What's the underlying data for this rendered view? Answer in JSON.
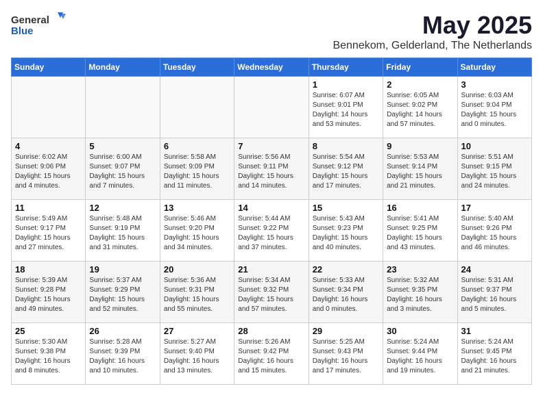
{
  "header": {
    "logo_general": "General",
    "logo_blue": "Blue",
    "month_year": "May 2025",
    "location": "Bennekom, Gelderland, The Netherlands"
  },
  "weekdays": [
    "Sunday",
    "Monday",
    "Tuesday",
    "Wednesday",
    "Thursday",
    "Friday",
    "Saturday"
  ],
  "weeks": [
    [
      {
        "day": "",
        "info": ""
      },
      {
        "day": "",
        "info": ""
      },
      {
        "day": "",
        "info": ""
      },
      {
        "day": "",
        "info": ""
      },
      {
        "day": "1",
        "info": "Sunrise: 6:07 AM\nSunset: 9:01 PM\nDaylight: 14 hours\nand 53 minutes."
      },
      {
        "day": "2",
        "info": "Sunrise: 6:05 AM\nSunset: 9:02 PM\nDaylight: 14 hours\nand 57 minutes."
      },
      {
        "day": "3",
        "info": "Sunrise: 6:03 AM\nSunset: 9:04 PM\nDaylight: 15 hours\nand 0 minutes."
      }
    ],
    [
      {
        "day": "4",
        "info": "Sunrise: 6:02 AM\nSunset: 9:06 PM\nDaylight: 15 hours\nand 4 minutes."
      },
      {
        "day": "5",
        "info": "Sunrise: 6:00 AM\nSunset: 9:07 PM\nDaylight: 15 hours\nand 7 minutes."
      },
      {
        "day": "6",
        "info": "Sunrise: 5:58 AM\nSunset: 9:09 PM\nDaylight: 15 hours\nand 11 minutes."
      },
      {
        "day": "7",
        "info": "Sunrise: 5:56 AM\nSunset: 9:11 PM\nDaylight: 15 hours\nand 14 minutes."
      },
      {
        "day": "8",
        "info": "Sunrise: 5:54 AM\nSunset: 9:12 PM\nDaylight: 15 hours\nand 17 minutes."
      },
      {
        "day": "9",
        "info": "Sunrise: 5:53 AM\nSunset: 9:14 PM\nDaylight: 15 hours\nand 21 minutes."
      },
      {
        "day": "10",
        "info": "Sunrise: 5:51 AM\nSunset: 9:15 PM\nDaylight: 15 hours\nand 24 minutes."
      }
    ],
    [
      {
        "day": "11",
        "info": "Sunrise: 5:49 AM\nSunset: 9:17 PM\nDaylight: 15 hours\nand 27 minutes."
      },
      {
        "day": "12",
        "info": "Sunrise: 5:48 AM\nSunset: 9:19 PM\nDaylight: 15 hours\nand 31 minutes."
      },
      {
        "day": "13",
        "info": "Sunrise: 5:46 AM\nSunset: 9:20 PM\nDaylight: 15 hours\nand 34 minutes."
      },
      {
        "day": "14",
        "info": "Sunrise: 5:44 AM\nSunset: 9:22 PM\nDaylight: 15 hours\nand 37 minutes."
      },
      {
        "day": "15",
        "info": "Sunrise: 5:43 AM\nSunset: 9:23 PM\nDaylight: 15 hours\nand 40 minutes."
      },
      {
        "day": "16",
        "info": "Sunrise: 5:41 AM\nSunset: 9:25 PM\nDaylight: 15 hours\nand 43 minutes."
      },
      {
        "day": "17",
        "info": "Sunrise: 5:40 AM\nSunset: 9:26 PM\nDaylight: 15 hours\nand 46 minutes."
      }
    ],
    [
      {
        "day": "18",
        "info": "Sunrise: 5:39 AM\nSunset: 9:28 PM\nDaylight: 15 hours\nand 49 minutes."
      },
      {
        "day": "19",
        "info": "Sunrise: 5:37 AM\nSunset: 9:29 PM\nDaylight: 15 hours\nand 52 minutes."
      },
      {
        "day": "20",
        "info": "Sunrise: 5:36 AM\nSunset: 9:31 PM\nDaylight: 15 hours\nand 55 minutes."
      },
      {
        "day": "21",
        "info": "Sunrise: 5:34 AM\nSunset: 9:32 PM\nDaylight: 15 hours\nand 57 minutes."
      },
      {
        "day": "22",
        "info": "Sunrise: 5:33 AM\nSunset: 9:34 PM\nDaylight: 16 hours\nand 0 minutes."
      },
      {
        "day": "23",
        "info": "Sunrise: 5:32 AM\nSunset: 9:35 PM\nDaylight: 16 hours\nand 3 minutes."
      },
      {
        "day": "24",
        "info": "Sunrise: 5:31 AM\nSunset: 9:37 PM\nDaylight: 16 hours\nand 5 minutes."
      }
    ],
    [
      {
        "day": "25",
        "info": "Sunrise: 5:30 AM\nSunset: 9:38 PM\nDaylight: 16 hours\nand 8 minutes."
      },
      {
        "day": "26",
        "info": "Sunrise: 5:28 AM\nSunset: 9:39 PM\nDaylight: 16 hours\nand 10 minutes."
      },
      {
        "day": "27",
        "info": "Sunrise: 5:27 AM\nSunset: 9:40 PM\nDaylight: 16 hours\nand 13 minutes."
      },
      {
        "day": "28",
        "info": "Sunrise: 5:26 AM\nSunset: 9:42 PM\nDaylight: 16 hours\nand 15 minutes."
      },
      {
        "day": "29",
        "info": "Sunrise: 5:25 AM\nSunset: 9:43 PM\nDaylight: 16 hours\nand 17 minutes."
      },
      {
        "day": "30",
        "info": "Sunrise: 5:24 AM\nSunset: 9:44 PM\nDaylight: 16 hours\nand 19 minutes."
      },
      {
        "day": "31",
        "info": "Sunrise: 5:24 AM\nSunset: 9:45 PM\nDaylight: 16 hours\nand 21 minutes."
      }
    ]
  ]
}
